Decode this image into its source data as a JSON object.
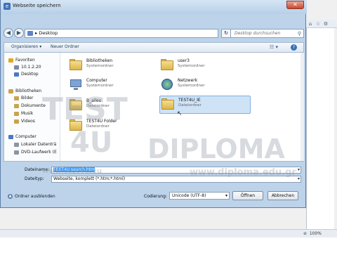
{
  "dialog": {
    "title": "Webseite speichern",
    "close": "✕"
  },
  "address": {
    "path": "Desktop",
    "chevron": "▸",
    "search_placeholder": "Desktop durchsuchen"
  },
  "toolbar": {
    "organize": "Organisieren ▾",
    "new_folder": "Neuer Ordner",
    "view_icon": "☷ ▾",
    "help_icon": "?"
  },
  "nav": {
    "items": [
      {
        "label": "Favoriten",
        "icon": "star-icon",
        "color": "#e3a81f"
      },
      {
        "label": "10.1.2.20",
        "icon": "network-drive-icon",
        "color": "#7a8aa0"
      },
      {
        "label": "Desktop",
        "icon": "desktop-icon",
        "color": "#4a78c4"
      },
      {
        "label": "Bibliotheken",
        "icon": "library-icon",
        "color": "#c9a34e"
      },
      {
        "label": "Bilder",
        "icon": "pictures-icon",
        "color": "#c9a34e"
      },
      {
        "label": "Dokumente",
        "icon": "documents-icon",
        "color": "#c9a34e"
      },
      {
        "label": "Musik",
        "icon": "music-icon",
        "color": "#c9a34e"
      },
      {
        "label": "Videos",
        "icon": "videos-icon",
        "color": "#c9a34e"
      },
      {
        "label": "Computer",
        "icon": "computer-icon",
        "color": "#4a78c4"
      },
      {
        "label": "Lokaler Datenträ",
        "icon": "drive-icon",
        "color": "#8a96a6"
      },
      {
        "label": "DVD-Laufwerk (E",
        "icon": "dvd-icon",
        "color": "#8a96a6"
      }
    ]
  },
  "files": [
    {
      "name": "Bibliotheken",
      "type": "Systemordner",
      "icon": "library-folder-icon"
    },
    {
      "name": "user3",
      "type": "Systemordner",
      "icon": "user-folder-icon"
    },
    {
      "name": "Computer",
      "type": "Systemordner",
      "icon": "computer-icon"
    },
    {
      "name": "Netzwerk",
      "type": "Systemordner",
      "icon": "network-icon"
    },
    {
      "name": "B_alles",
      "type": "Dateiordner",
      "icon": "folder-icon"
    },
    {
      "name": "TEST4U_IE",
      "type": "Dateiordner",
      "icon": "folder-icon",
      "selected": true
    },
    {
      "name": "TEST4U Folder",
      "type": "Dateiordner",
      "icon": "folder-icon"
    }
  ],
  "form": {
    "filename_label": "Dateiname:",
    "filename_value": "TEST4U search.htm",
    "filetype_label": "Dateityp:",
    "filetype_value": "Webseite, komplett (*.htm;*.html)"
  },
  "bottom": {
    "hide_folders": "Ordner ausblenden",
    "encoding_label": "Codierung:",
    "encoding_value": "Unicode (UTF-8)",
    "save": "Öffnen",
    "cancel": "Abbrechen"
  },
  "browser": {
    "zoom": "100%",
    "back_icon": "◀",
    "forward_icon": "▶"
  },
  "watermark": {
    "brand1": "TEST",
    "brand2": "4U",
    "brand3": "DIPLOMA",
    "site1": "www.test4u.eu",
    "site2": "www.diploma.edu.gr"
  }
}
